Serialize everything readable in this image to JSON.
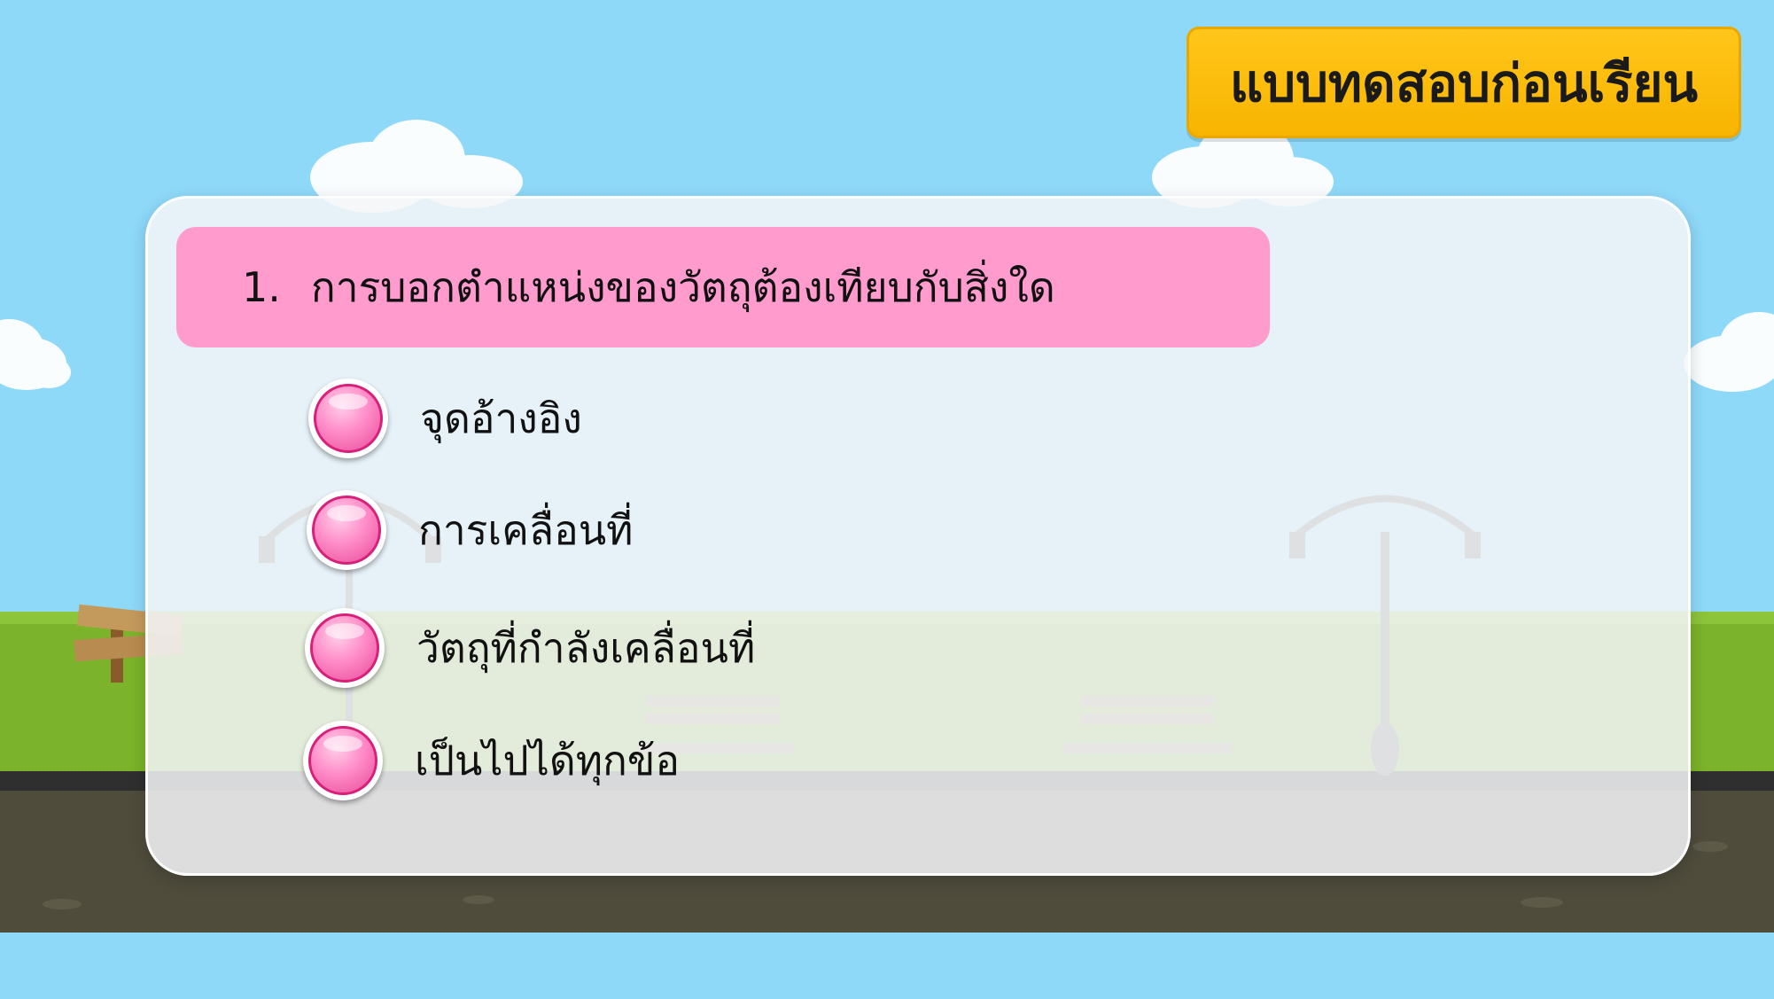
{
  "header": {
    "title": "แบบทดสอบก่อนเรียน"
  },
  "question": {
    "number": "1.",
    "text": "การบอกตำแหน่งของวัตถุต้องเทียบกับสิ่งใด"
  },
  "options": [
    {
      "label": "จุดอ้างอิง"
    },
    {
      "label": "การเคลื่อนที่"
    },
    {
      "label": "วัตถุที่กำลังเคลื่อนที่"
    },
    {
      "label": "เป็นไปได้ทุกข้อ"
    }
  ],
  "colors": {
    "sky": "#8ed8f8",
    "title_badge": "#ffc61a",
    "question_bar": "#ff9ccd",
    "radio_pink": "#ff8cc8",
    "grass": "#7bb32a",
    "road": "#4a4a3a"
  }
}
